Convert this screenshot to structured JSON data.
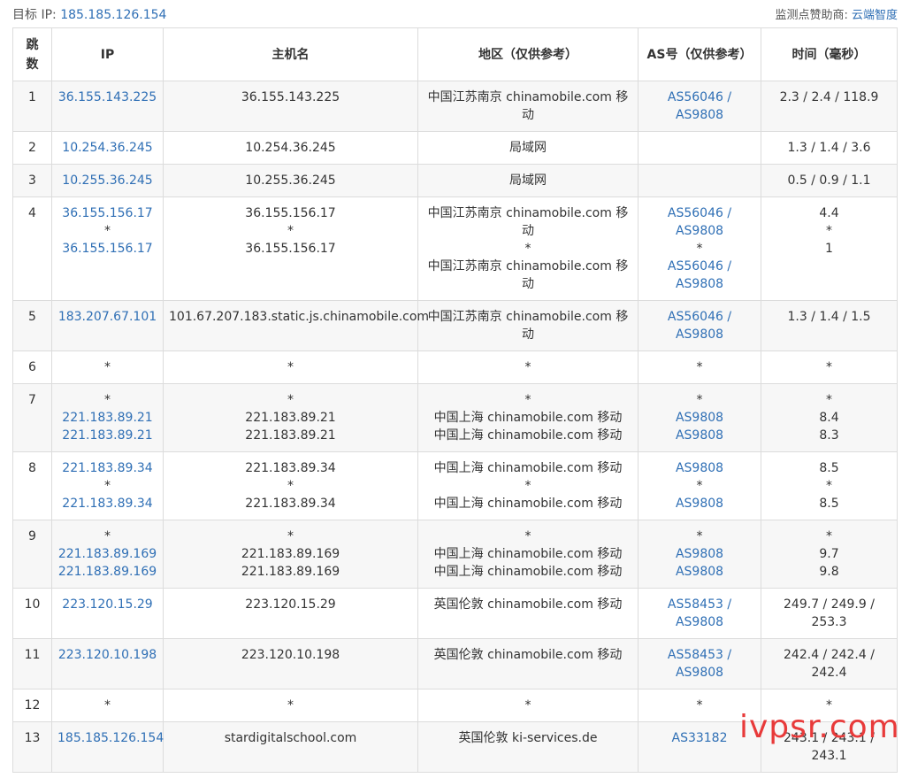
{
  "target_label": "目标 IP:",
  "target_ip": "185.185.126.154",
  "sponsor_label": "监测点赞助商:",
  "sponsor_name": "云端智度",
  "columns": [
    "跳数",
    "IP",
    "主机名",
    "地区（仅供参考）",
    "AS号（仅供参考）",
    "时间（毫秒）"
  ],
  "rows": [
    {
      "hop": "1",
      "ips": [
        "36.155.143.225"
      ],
      "hosts": [
        "36.155.143.225"
      ],
      "regions": [
        "中国江苏南京 chinamobile.com 移动"
      ],
      "as": [
        "AS56046 / AS9808"
      ],
      "times": [
        "2.3 / 2.4 / 118.9"
      ]
    },
    {
      "hop": "2",
      "ips": [
        "10.254.36.245"
      ],
      "hosts": [
        "10.254.36.245"
      ],
      "regions": [
        "局域网"
      ],
      "as": [
        ""
      ],
      "times": [
        "1.3 / 1.4 / 3.6"
      ]
    },
    {
      "hop": "3",
      "ips": [
        "10.255.36.245"
      ],
      "hosts": [
        "10.255.36.245"
      ],
      "regions": [
        "局域网"
      ],
      "as": [
        ""
      ],
      "times": [
        "0.5 / 0.9 / 1.1"
      ]
    },
    {
      "hop": "4",
      "ips": [
        "36.155.156.17",
        "*",
        "36.155.156.17"
      ],
      "hosts": [
        "36.155.156.17",
        "*",
        "36.155.156.17"
      ],
      "regions": [
        "中国江苏南京 chinamobile.com 移动",
        "*",
        "中国江苏南京 chinamobile.com 移动"
      ],
      "as": [
        "AS56046 / AS9808",
        "*",
        "AS56046 / AS9808"
      ],
      "times": [
        "4.4",
        "*",
        "1"
      ]
    },
    {
      "hop": "5",
      "ips": [
        "183.207.67.101"
      ],
      "hosts": [
        "101.67.207.183.static.js.chinamobile.com"
      ],
      "regions": [
        "中国江苏南京 chinamobile.com 移动"
      ],
      "as": [
        "AS56046 / AS9808"
      ],
      "times": [
        "1.3 / 1.4 / 1.5"
      ]
    },
    {
      "hop": "6",
      "ips": [
        "*"
      ],
      "hosts": [
        "*"
      ],
      "regions": [
        "*"
      ],
      "as": [
        "*"
      ],
      "times": [
        "*"
      ]
    },
    {
      "hop": "7",
      "ips": [
        "*",
        "221.183.89.21",
        "221.183.89.21"
      ],
      "hosts": [
        "*",
        "221.183.89.21",
        "221.183.89.21"
      ],
      "regions": [
        "*",
        "中国上海 chinamobile.com 移动",
        "中国上海 chinamobile.com 移动"
      ],
      "as": [
        "*",
        "AS9808",
        "AS9808"
      ],
      "times": [
        "*",
        "8.4",
        "8.3"
      ]
    },
    {
      "hop": "8",
      "ips": [
        "221.183.89.34",
        "*",
        "221.183.89.34"
      ],
      "hosts": [
        "221.183.89.34",
        "*",
        "221.183.89.34"
      ],
      "regions": [
        "中国上海 chinamobile.com 移动",
        "*",
        "中国上海 chinamobile.com 移动"
      ],
      "as": [
        "AS9808",
        "*",
        "AS9808"
      ],
      "times": [
        "8.5",
        "*",
        "8.5"
      ]
    },
    {
      "hop": "9",
      "ips": [
        "*",
        "221.183.89.169",
        "221.183.89.169"
      ],
      "hosts": [
        "*",
        "221.183.89.169",
        "221.183.89.169"
      ],
      "regions": [
        "*",
        "中国上海 chinamobile.com 移动",
        "中国上海 chinamobile.com 移动"
      ],
      "as": [
        "*",
        "AS9808",
        "AS9808"
      ],
      "times": [
        "*",
        "9.7",
        "9.8"
      ]
    },
    {
      "hop": "10",
      "ips": [
        "223.120.15.29"
      ],
      "hosts": [
        "223.120.15.29"
      ],
      "regions": [
        "英国伦敦 chinamobile.com 移动"
      ],
      "as": [
        "AS58453 / AS9808"
      ],
      "times": [
        "249.7 / 249.9 / 253.3"
      ]
    },
    {
      "hop": "11",
      "ips": [
        "223.120.10.198"
      ],
      "hosts": [
        "223.120.10.198"
      ],
      "regions": [
        "英国伦敦 chinamobile.com 移动"
      ],
      "as": [
        "AS58453 / AS9808"
      ],
      "times": [
        "242.4 / 242.4 / 242.4"
      ]
    },
    {
      "hop": "12",
      "ips": [
        "*"
      ],
      "hosts": [
        "*"
      ],
      "regions": [
        "*"
      ],
      "as": [
        "*"
      ],
      "times": [
        "*"
      ]
    },
    {
      "hop": "13",
      "ips": [
        "185.185.126.154"
      ],
      "hosts": [
        "stardigitalschool.com"
      ],
      "regions": [
        "英国伦敦 ki-services.de"
      ],
      "as": [
        "AS33182"
      ],
      "times": [
        "243.1 / 243.1 / 243.1"
      ]
    }
  ],
  "watermark": "ivpsr.com"
}
